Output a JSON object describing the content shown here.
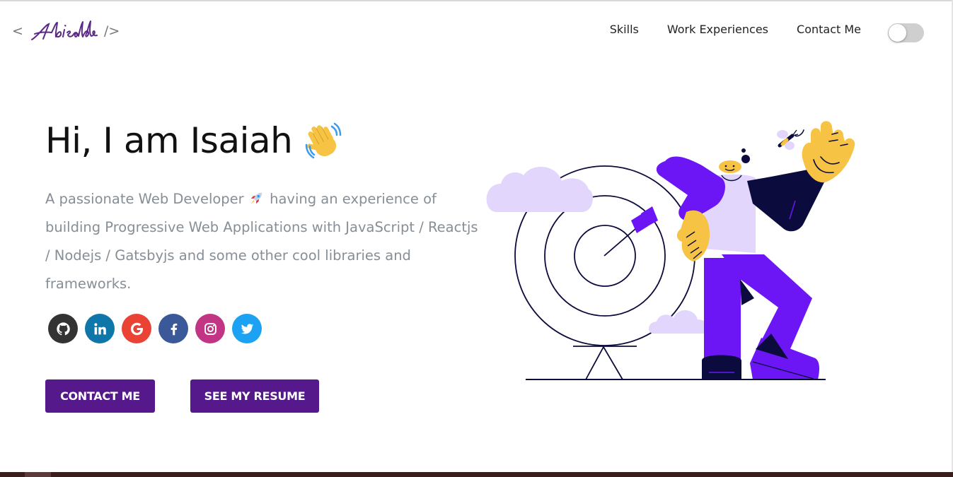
{
  "header": {
    "logo_left": "<",
    "logo_signature": "Abisalde",
    "logo_right": "/>",
    "nav": [
      "Skills",
      "Work Experiences",
      "Contact Me"
    ]
  },
  "theme_toggle": {
    "state": "off"
  },
  "hero": {
    "greeting": "Hi, I am Isaiah",
    "greeting_emoji": "waving-hand-icon",
    "tagline_before": "A passionate Web Developer",
    "tagline_emoji": "rocket-icon",
    "tagline_after": "having an experience of building Progressive Web Applications with JavaScript / Reactjs / Nodejs / Gatsbyjs and some other cool libraries and frameworks.",
    "socials": [
      {
        "name": "github",
        "icon": "github-icon",
        "color": "#333333"
      },
      {
        "name": "linkedin",
        "icon": "linkedin-icon",
        "color": "#0e76a8"
      },
      {
        "name": "google",
        "icon": "google-icon",
        "color": "#ea4335"
      },
      {
        "name": "facebook",
        "icon": "facebook-icon",
        "color": "#3b5998"
      },
      {
        "name": "instagram",
        "icon": "instagram-icon",
        "color": "#c13584"
      },
      {
        "name": "twitter",
        "icon": "twitter-icon",
        "color": "#1da1f2"
      }
    ],
    "contact_button": "CONTACT ME",
    "resume_button": "SEE MY RESUME"
  },
  "colors": {
    "primary_button": "#55198b",
    "accent_purple": "#6c16f5",
    "light_purple": "#e2d6fd",
    "skin": "#f6c344",
    "navy": "#0c0b3d",
    "subtitle_gray": "#868e96"
  }
}
